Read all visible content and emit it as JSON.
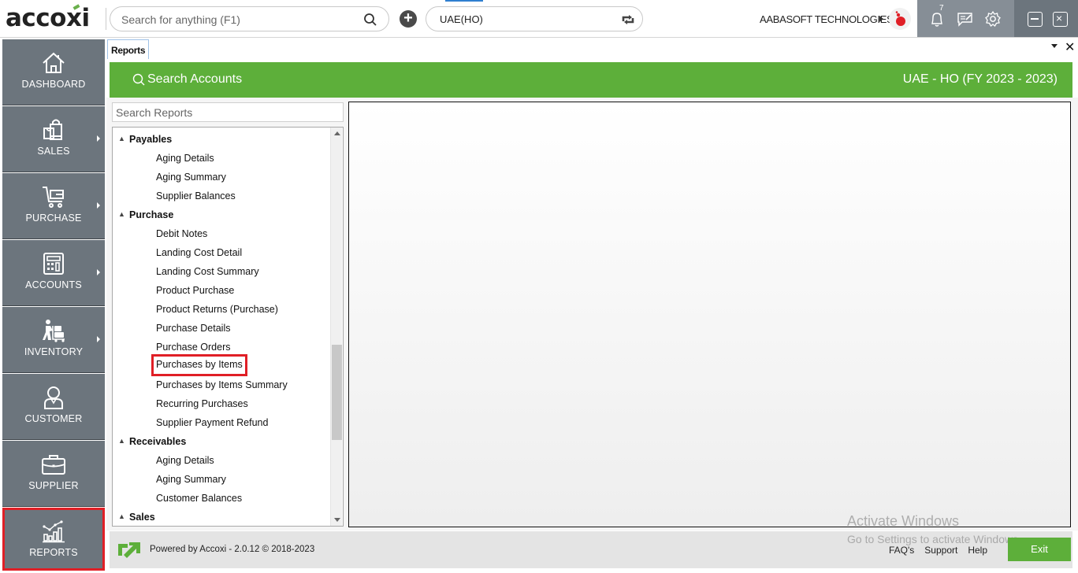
{
  "app": {
    "logo_text": "accoxi",
    "global_search": {
      "placeholder": "Search for anything (F1)",
      "value": ""
    },
    "branch": "UAE(HO)",
    "company": "AABASOFT TECHNOLOGIES",
    "notifications_count": "7"
  },
  "sidebar": {
    "items": [
      {
        "label": "DASHBOARD",
        "icon": "home-icon",
        "has_submenu": false
      },
      {
        "label": "SALES",
        "icon": "shopping-bags-icon",
        "has_submenu": true
      },
      {
        "label": "PURCHASE",
        "icon": "cart-icon",
        "has_submenu": true
      },
      {
        "label": "ACCOUNTS",
        "icon": "calculator-icon",
        "has_submenu": true
      },
      {
        "label": "INVENTORY",
        "icon": "worker-trolley-icon",
        "has_submenu": true
      },
      {
        "label": "CUSTOMER",
        "icon": "user-icon",
        "has_submenu": false
      },
      {
        "label": "SUPPLIER",
        "icon": "briefcase-icon",
        "has_submenu": false
      },
      {
        "label": "REPORTS",
        "icon": "chart-icon",
        "has_submenu": false,
        "active": true
      }
    ]
  },
  "tabs": [
    {
      "label": "Reports",
      "active": true
    }
  ],
  "header": {
    "search_accounts_label": "Search Accounts",
    "company_fy": "UAE - HO (FY 2023 - 2023)"
  },
  "reports": {
    "search_placeholder": "Search Reports",
    "tree": [
      {
        "type": "group",
        "label": "Payables"
      },
      {
        "type": "item",
        "label": "Aging Details"
      },
      {
        "type": "item",
        "label": "Aging Summary"
      },
      {
        "type": "item",
        "label": "Supplier Balances"
      },
      {
        "type": "group",
        "label": "Purchase"
      },
      {
        "type": "item",
        "label": "Debit Notes"
      },
      {
        "type": "item",
        "label": "Landing Cost Detail"
      },
      {
        "type": "item",
        "label": "Landing Cost Summary"
      },
      {
        "type": "item",
        "label": "Product Purchase"
      },
      {
        "type": "item",
        "label": "Product Returns (Purchase)"
      },
      {
        "type": "item",
        "label": "Purchase Details"
      },
      {
        "type": "item",
        "label": "Purchase Orders"
      },
      {
        "type": "item",
        "label": "Purchases by Items",
        "highlighted": true
      },
      {
        "type": "item",
        "label": "Purchases by Items Summary"
      },
      {
        "type": "item",
        "label": "Recurring Purchases"
      },
      {
        "type": "item",
        "label": "Supplier Payment Refund"
      },
      {
        "type": "group",
        "label": "Receivables"
      },
      {
        "type": "item",
        "label": "Aging Details"
      },
      {
        "type": "item",
        "label": "Aging Summary"
      },
      {
        "type": "item",
        "label": "Customer Balances"
      },
      {
        "type": "group",
        "label": "Sales"
      }
    ]
  },
  "footer": {
    "powered_by": "Powered by Accoxi - 2.0.12 © 2018-2023",
    "links": [
      "FAQ's",
      "Support",
      "Help"
    ],
    "exit_label": "Exit"
  },
  "watermark": {
    "title": "Activate Windows",
    "subtitle": "Go to Settings to activate Windows."
  },
  "colors": {
    "brand_green": "#5daf3a",
    "sidebar_gray": "#6c757d",
    "highlight_red": "#e01f26"
  }
}
